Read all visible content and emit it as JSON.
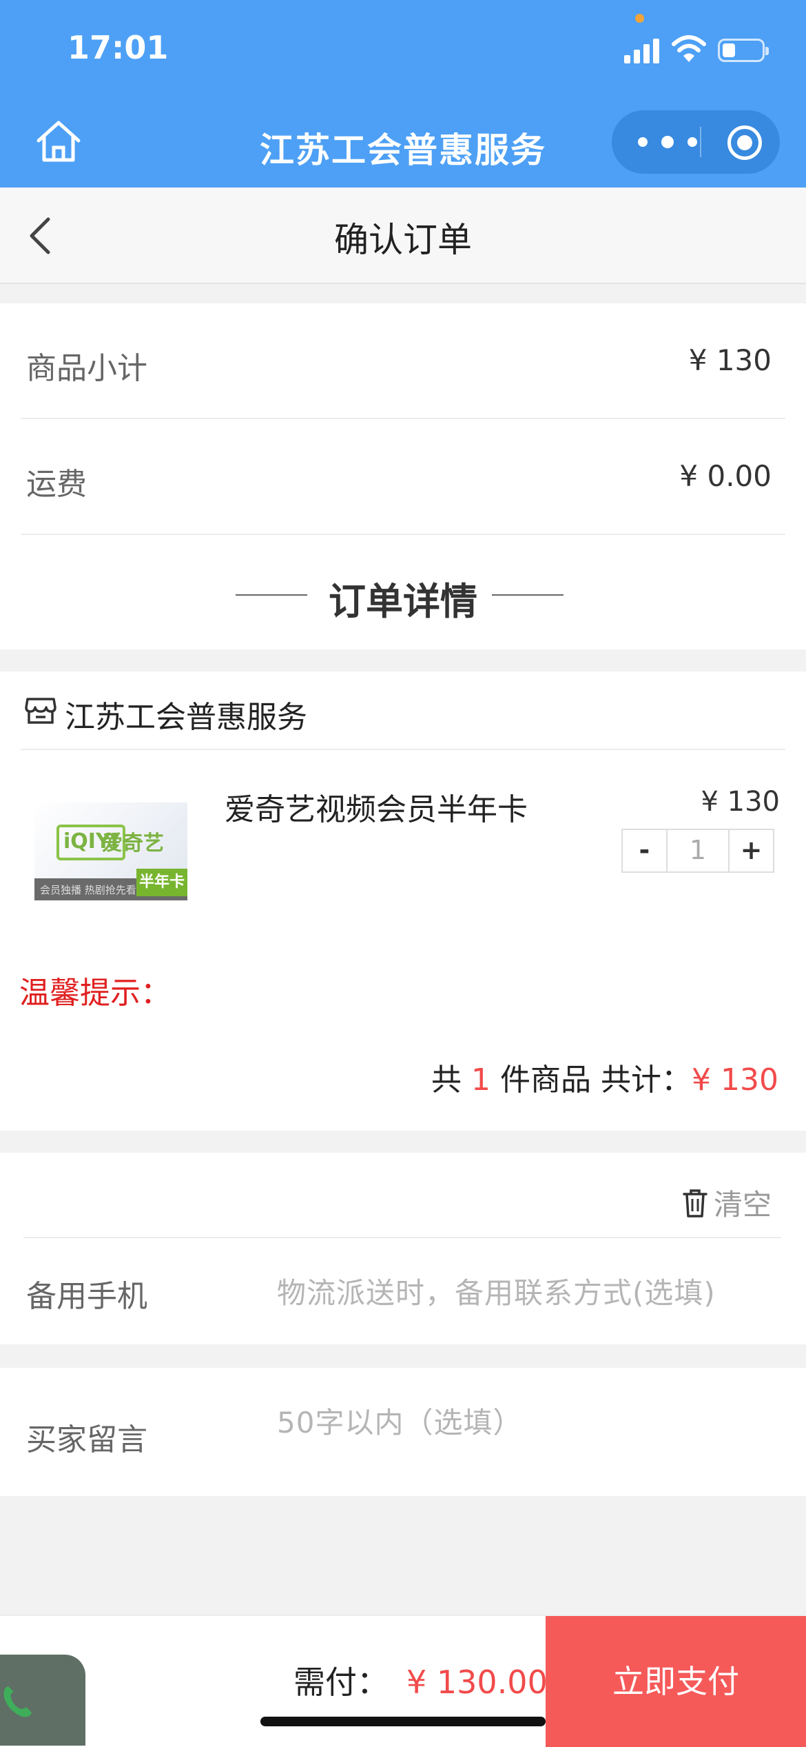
{
  "status_bar": {
    "time": "17:01"
  },
  "header": {
    "title": "江苏工会普惠服务",
    "icons": [
      "home-icon",
      "more-icon",
      "target-icon"
    ]
  },
  "nav": {
    "title": "确认订单",
    "back_icon": "chevron-left-icon"
  },
  "summary": {
    "subtotal_label": "商品小计",
    "subtotal_value": "¥ 130",
    "shipping_label": "运费",
    "shipping_value": "¥ 0.00",
    "detail_title": "订单详情"
  },
  "order": {
    "store_name": "江苏工会普惠服务",
    "product": {
      "name": "爱奇艺视频会员半年卡",
      "price": "¥ 130",
      "quantity": "1",
      "minus": "-",
      "plus": "+",
      "thumb_logo": "iQIYI",
      "thumb_brand": "爱奇艺",
      "thumb_caption": "会员独播 热剧抢先看",
      "thumb_tag": "半年卡"
    },
    "tip_label": "温馨提示：",
    "total_prefix": "共",
    "total_count": "1",
    "total_middle": "件商品 共计：",
    "total_amount": "¥ 130"
  },
  "contact": {
    "clear_label": "清空",
    "phone_label": "备用手机",
    "phone_placeholder": "物流派送时，备用联系方式(选填)",
    "message_label": "买家留言",
    "message_placeholder": "50字以内（选填）"
  },
  "footer": {
    "pay_label": "需付：",
    "pay_amount": "¥ 130.00",
    "pay_button": "立即支付"
  },
  "colors": {
    "header_blue": "#4da0f5",
    "price_red": "#f24a4a",
    "pay_button": "#f55a59",
    "tip_red": "#e02020"
  }
}
